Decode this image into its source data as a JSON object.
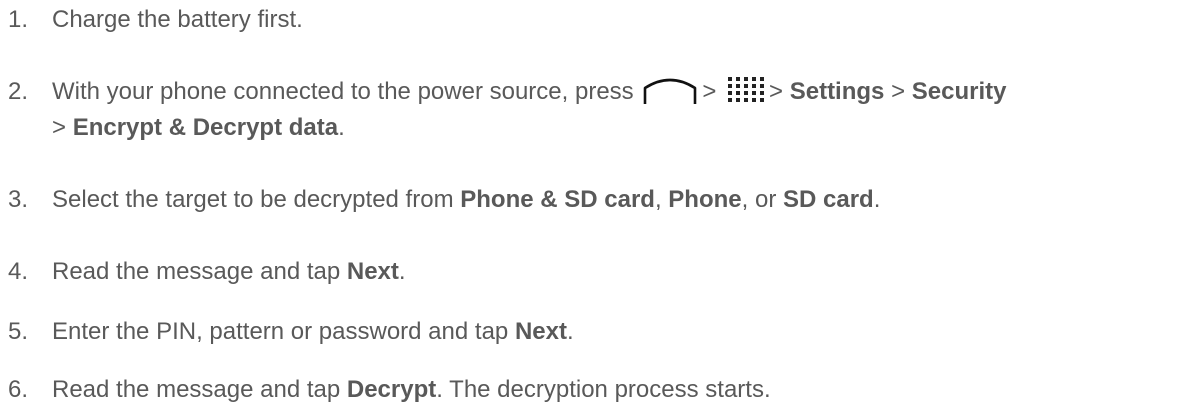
{
  "steps": [
    {
      "number": "1.",
      "text": "Charge the battery first."
    },
    {
      "number": "2.",
      "pre": "With your phone connected to the power source, press",
      "sep1": ">",
      "sep2": ">",
      "settings": "Settings",
      "sep3": ">",
      "security": "Security",
      "sep4": ">",
      "encrypt": "Encrypt & Decrypt data",
      "end": ".",
      "icons": [
        "home-icon",
        "apps-grid-icon"
      ]
    },
    {
      "number": "3.",
      "pre": "Select the target to be decrypted from",
      "opt1": "Phone & SD card",
      "comma1": ",",
      "opt2": "Phone",
      "or": ", or",
      "opt3": "SD card",
      "end": "."
    },
    {
      "number": "4.",
      "pre": "Read the message and tap",
      "action": "Next",
      "end": "."
    },
    {
      "number": "5.",
      "pre": "Enter the PIN, pattern or password and tap",
      "action": "Next",
      "end": "."
    },
    {
      "number": "6.",
      "pre": "Read the message and tap",
      "action": "Decrypt",
      "post": ". The decryption process starts."
    }
  ]
}
